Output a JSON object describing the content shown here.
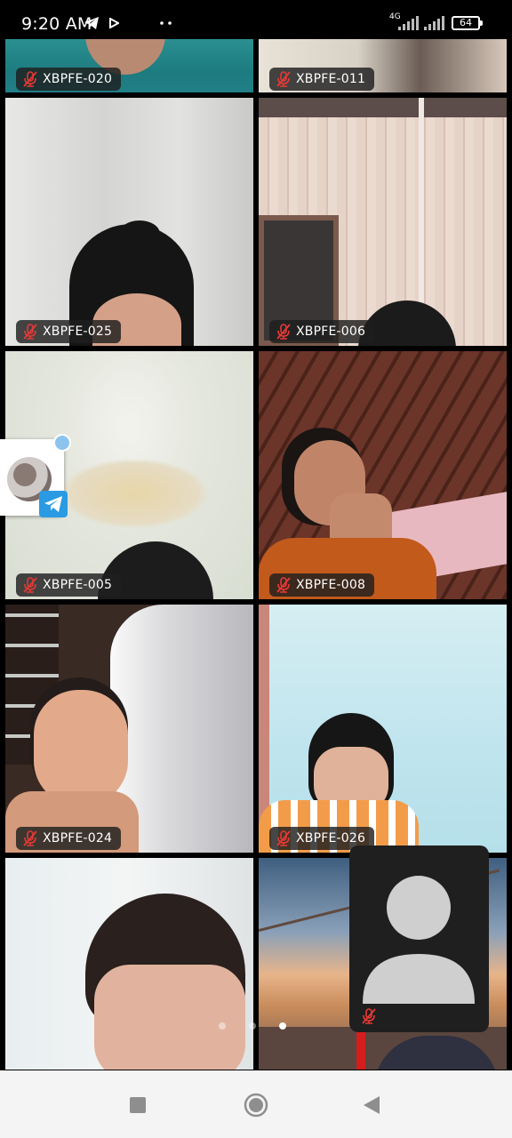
{
  "status_bar": {
    "time": "9:20 AM",
    "network_label": "4G",
    "battery_level": "64",
    "icons": [
      "telegram-icon",
      "play-icon",
      "more-dots-icon",
      "signal-icon",
      "battery-icon"
    ]
  },
  "participants": [
    {
      "name": "XBPFE-020",
      "muted": true
    },
    {
      "name": "XBPFE-011",
      "muted": true
    },
    {
      "name": "XBPFE-025",
      "muted": true
    },
    {
      "name": "XBPFE-006",
      "muted": true
    },
    {
      "name": "XBPFE-005",
      "muted": true
    },
    {
      "name": "XBPFE-008",
      "muted": true
    },
    {
      "name": "XBPFE-024",
      "muted": true
    },
    {
      "name": "XBPFE-026",
      "muted": true
    }
  ],
  "self_view": {
    "camera_on": false,
    "muted": true,
    "icon": "user-silhouette-icon"
  },
  "pagination": {
    "pages": 3,
    "current": 3
  },
  "nav_bar": {
    "icons": [
      "recents-square-icon",
      "home-circle-icon",
      "back-triangle-icon"
    ]
  },
  "colors": {
    "mute_icon": "#e53935",
    "label_bg": "#1e1e1e",
    "nav_bg": "#f4f4f4",
    "telegram": "#2a9be2"
  }
}
